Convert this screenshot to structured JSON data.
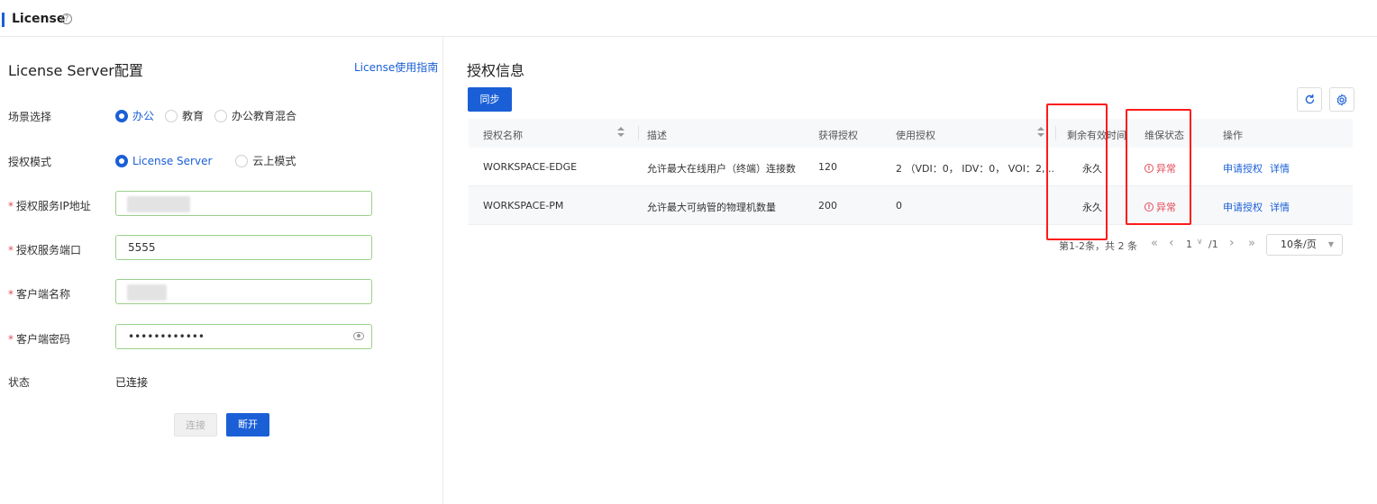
{
  "header": {
    "title": "License",
    "help_icon": "question-circle-icon"
  },
  "left": {
    "title": "License Server配置",
    "guide_link": "License使用指南",
    "scene": {
      "label": "场景选择",
      "options": [
        "办公",
        "教育",
        "办公教育混合"
      ],
      "selected": "办公"
    },
    "mode": {
      "label": "授权模式",
      "options": [
        "License Server",
        "云上模式"
      ],
      "selected": "License Server"
    },
    "ip": {
      "label": "授权服务IP地址",
      "required": "*"
    },
    "port": {
      "label": "授权服务端口",
      "required": "*",
      "value": "5555"
    },
    "client_name": {
      "label": "客户端名称",
      "required": "*"
    },
    "client_pwd": {
      "label": "客户端密码",
      "required": "*",
      "value": "••••••••••••"
    },
    "status": {
      "label": "状态",
      "value": "已连接"
    },
    "connect_label": "连接",
    "disconnect_label": "断开"
  },
  "right": {
    "title": "授权信息",
    "sync_label": "同步",
    "refresh_icon": "refresh-icon",
    "settings_icon": "gear-icon",
    "columns": [
      "授权名称",
      "描述",
      "获得授权",
      "使用授权",
      "剩余有效时间",
      "维保状态",
      "操作"
    ],
    "rows": [
      {
        "name": "WORKSPACE-EDGE",
        "desc": "允许最大在线用户（终端）连接数",
        "granted": "120",
        "used": "2 （VDI：0， IDV：0， VOI：2, ...",
        "remaining": "永久",
        "maint": "异常",
        "op_apply": "申请授权",
        "op_detail": "详情"
      },
      {
        "name": "WORKSPACE-PM",
        "desc": "允许最大可纳管的物理机数量",
        "granted": "200",
        "used": "0",
        "remaining": "永久",
        "maint": "异常",
        "op_apply": "申请授权",
        "op_detail": "详情"
      }
    ],
    "pagination": {
      "summary": "第1-2条，共 2 条",
      "first": "«",
      "prev": "‹",
      "current": "1",
      "chevron": "∨",
      "total": "/1",
      "next": "›",
      "last": "»",
      "page_size": "10条/页"
    }
  },
  "colors": {
    "primary": "#1a5fd6",
    "danger": "#e34d59",
    "highlight": "#ff1a1a",
    "success_border": "#9bd08a"
  }
}
